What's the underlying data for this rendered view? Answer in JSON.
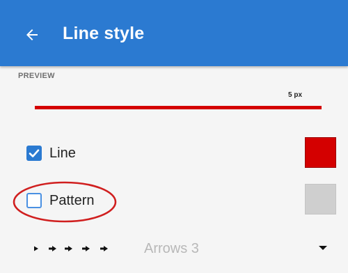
{
  "appbar": {
    "title": "Line style",
    "back_icon": "arrow-left-icon",
    "color": "#2b7ad1"
  },
  "preview": {
    "section_label": "PREVIEW",
    "width_label": "5 px",
    "line_color": "#d40000"
  },
  "options": {
    "line": {
      "label": "Line",
      "checked": true,
      "color": "#d40000"
    },
    "pattern": {
      "label": "Pattern",
      "checked": false,
      "color": "#cfcfcf",
      "highlighted": true,
      "highlight_color": "#d01f1f"
    }
  },
  "arrows": {
    "selected": "Arrows 3",
    "dropdown_icon": "caret-down-icon"
  }
}
